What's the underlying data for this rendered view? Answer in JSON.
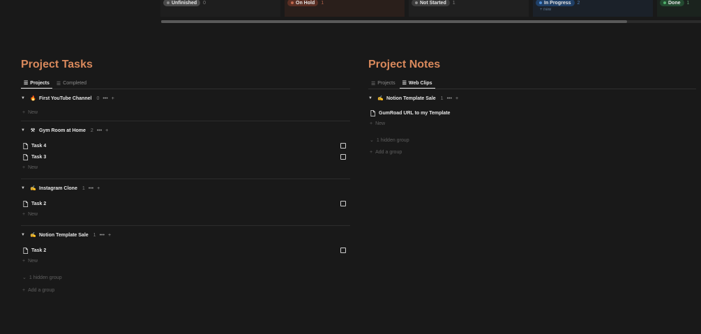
{
  "board": {
    "columns": [
      {
        "label": "Unfinished",
        "count": "0",
        "color": "#4a4a4a",
        "dot": "#8a8a8a"
      },
      {
        "label": "On Hold",
        "count": "1",
        "color": "#5a2f24",
        "dot": "#c0694e"
      },
      {
        "label": "Not Started",
        "count": "1",
        "color": "#3c3c3c",
        "dot": "#8f8f8f"
      },
      {
        "label": "In Progress",
        "count": "2",
        "color": "#1f3f66",
        "dot": "#4f8fd6"
      },
      {
        "label": "Done",
        "count": "1",
        "color": "#234a30",
        "dot": "#4fae6a"
      }
    ],
    "in_progress_new": "+ new"
  },
  "project_tasks": {
    "title": "Project Tasks",
    "tabs": [
      {
        "label": "Projects",
        "active": true
      },
      {
        "label": "Completed",
        "active": false
      }
    ],
    "groups": [
      {
        "name": "First YouTube Channel",
        "icon": "🔥",
        "count": "0",
        "tasks": []
      },
      {
        "name": "Gym Room at Home",
        "icon": "⚒",
        "count": "2",
        "tasks": [
          "Task 4",
          "Task 3"
        ]
      },
      {
        "name": "Instagram Clone",
        "icon": "✍",
        "count": "1",
        "tasks": [
          "Task 2"
        ]
      },
      {
        "name": "Notion Template Sale",
        "icon": "✍",
        "count": "1",
        "tasks": [
          "Task 2"
        ]
      }
    ],
    "new_label": "New",
    "hidden_group": "1 hidden group",
    "add_group": "Add a group"
  },
  "project_notes": {
    "title": "Project Notes",
    "tabs": [
      {
        "label": "Projects",
        "active": false
      },
      {
        "label": "Web Clips",
        "active": true
      }
    ],
    "group": {
      "name": "Notion Template Sale",
      "icon": "✍",
      "count": "1"
    },
    "items": [
      "GumRoad URL to my Template"
    ],
    "new_label": "New",
    "hidden_group": "1 hidden group",
    "add_group": "Add a group"
  },
  "icons": {
    "caret": "caret-down-icon",
    "more": "more-dots-icon",
    "plus": "plus-icon",
    "doc": "page-icon",
    "table": "table-icon",
    "chevron": "chevron-down-icon",
    "checkbox": "checkbox-icon"
  }
}
